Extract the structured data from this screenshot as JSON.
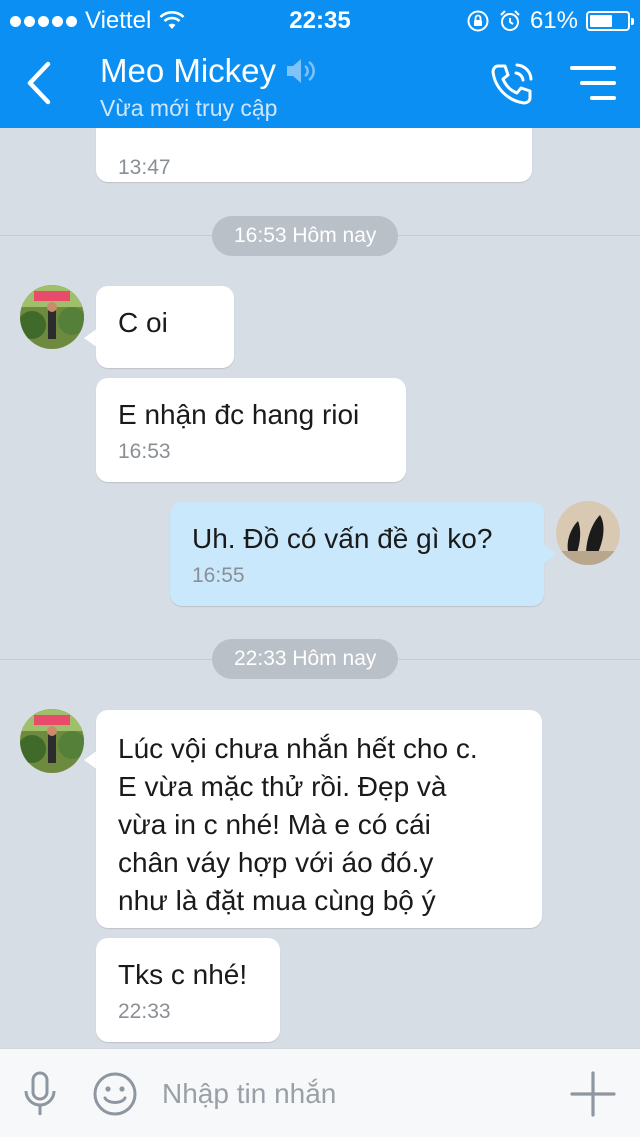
{
  "status_bar": {
    "carrier": "Viettel",
    "time": "22:35",
    "battery_percent": "61%",
    "battery_level": 0.61
  },
  "header": {
    "contact_name": "Meo Mickey",
    "presence": "Vừa mới truy cập",
    "accent_color": "#0c8ff3"
  },
  "messages": [
    {
      "time": "13:47"
    },
    {
      "divider": "16:53 Hôm nay"
    },
    {
      "text": "C oi"
    },
    {
      "text": "E nhận đc hang rioi",
      "time": "16:53"
    },
    {
      "text": "Uh. Đồ có vấn đề gì ko?",
      "time": "16:55"
    },
    {
      "divider": "22:33 Hôm nay"
    },
    {
      "text": "Lúc vội chưa nhắn hết cho c.\nE vừa mặc thử rồi. Đẹp và\nvừa in c nhé! Mà e có cái\nchân váy hợp với áo đó.y\nnhư là đặt mua cùng bộ ý"
    },
    {
      "text": "Tks c nhé!",
      "time": "22:33"
    }
  ],
  "input": {
    "placeholder": "Nhập tin nhắn"
  },
  "icons": {
    "back": "chevron-left-icon",
    "speaker": "speaker-icon",
    "call": "phone-icon",
    "menu": "menu-icon",
    "mic": "microphone-icon",
    "emoji": "emoji-icon",
    "plus": "plus-icon"
  }
}
